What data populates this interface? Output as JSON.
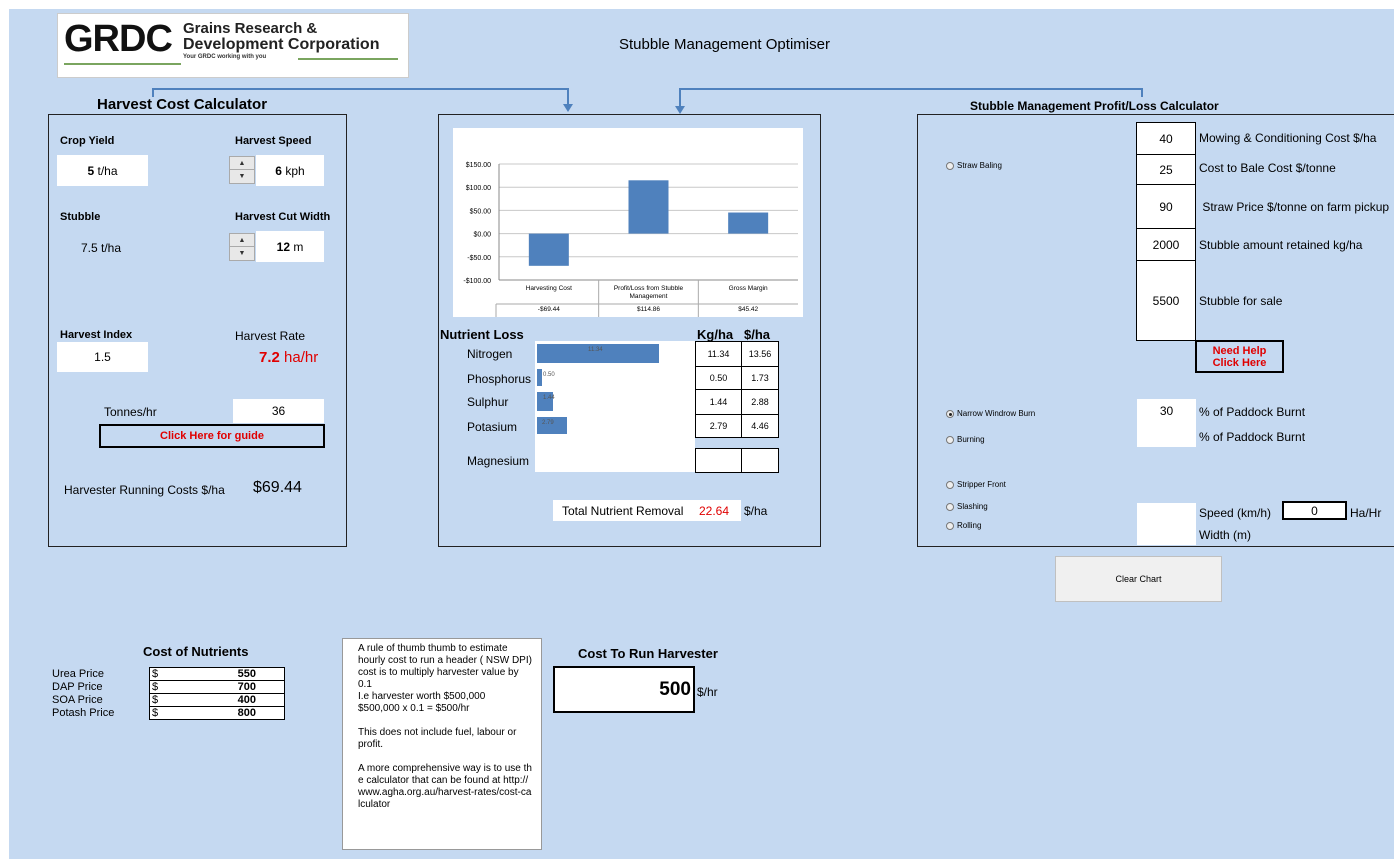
{
  "header": {
    "logo_main": "GRDC",
    "logo_line1": "Grains Research &",
    "logo_line2": "Development Corporation",
    "logo_tagline": "Your GRDC working with you",
    "title": "Stubble Management Optimiser"
  },
  "harvest_calc": {
    "title": "Harvest Cost Calculator",
    "crop_yield_label": "Crop Yield",
    "crop_yield_value": "5",
    "crop_yield_unit": "t/ha",
    "harvest_speed_label": "Harvest Speed",
    "harvest_speed_value": "6",
    "harvest_speed_unit": "kph",
    "stubble_label": "Stubble",
    "stubble_value": "7.5 t/ha",
    "cut_width_label": "Harvest Cut Width",
    "cut_width_value": "12",
    "cut_width_unit": "m",
    "harvest_index_label": "Harvest Index",
    "harvest_index_value": "1.5",
    "harvest_rate_label": "Harvest Rate",
    "harvest_rate_value": "7.2",
    "harvest_rate_unit": "ha/hr",
    "tonnes_hr_label": "Tonnes/hr",
    "tonnes_hr_value": "36",
    "guide_button": "Click Here for guide",
    "running_cost_label": "Harvester Running Costs $/ha",
    "running_cost_value": "$69.44"
  },
  "chart_data": {
    "type": "bar",
    "categories": [
      "Harvesting Cost",
      "Profit/Loss from Stubble Management",
      "Gross Margin"
    ],
    "values": [
      -69.44,
      114.86,
      45.42
    ],
    "value_labels": [
      "-$69.44",
      "$114.86",
      "$45.42"
    ],
    "ylim": [
      -100,
      150
    ],
    "yticks": [
      "$150.00",
      "$100.00",
      "$50.00",
      "$0.00",
      "-$50.00",
      "-$100.00"
    ],
    "ytick_values": [
      150,
      100,
      50,
      0,
      -50,
      -100
    ],
    "bar_color": "#4f81bd",
    "grid": true
  },
  "nutrients": {
    "title": "Nutrient Loss",
    "col_kg": "Kg/ha",
    "col_dollar": "$/ha",
    "rows": [
      {
        "name": "Nitrogen",
        "kg": "11.34",
        "dollar": "13.56",
        "bar": 11.34,
        "bar_label": "11.34"
      },
      {
        "name": "Phosphorus",
        "kg": "0.50",
        "dollar": "1.73",
        "bar": 0.5,
        "bar_label": "0.50"
      },
      {
        "name": "Sulphur",
        "kg": "1.44",
        "dollar": "2.88",
        "bar": 1.44,
        "bar_label": "1.44"
      },
      {
        "name": "Potasium",
        "kg": "2.79",
        "dollar": "4.46",
        "bar": 2.79,
        "bar_label": "2.79"
      },
      {
        "name": "Magnesium",
        "kg": "",
        "dollar": "",
        "bar": 0,
        "bar_label": ""
      }
    ],
    "bar_max": 13,
    "total_label": "Total Nutrient Removal",
    "total_value": "22.64",
    "total_unit": "$/ha"
  },
  "profit_loss": {
    "title": "Stubble Management Profit/Loss Calculator",
    "straw_baling": "Straw Baling",
    "rows": [
      {
        "value": "40",
        "label": "Mowing & Conditioning Cost $/ha"
      },
      {
        "value": "25",
        "label": "Cost to Bale Cost $/tonne"
      },
      {
        "value": "90",
        "label": " Straw Price $/tonne on farm pickup"
      },
      {
        "value": "2000",
        "label": "Stubble amount retained kg/ha"
      },
      {
        "value": "5500",
        "label": "Stubble for sale"
      }
    ],
    "need_help_line1": "Need Help",
    "need_help_line2": "Click Here",
    "narrow_windrow": "Narrow Windrow Burn",
    "narrow_windrow_value": "30",
    "narrow_windrow_unit": "% of Paddock Burnt",
    "burning": "Burning",
    "burning_unit": "% of Paddock Burnt",
    "stripper_front": "Stripper Front",
    "slashing": "Slashing",
    "rolling": "Rolling",
    "speed_label": "Speed (km/h)",
    "speed_result": "0",
    "speed_result_unit": "Ha/Hr",
    "width_label": "Width (m)",
    "clear_chart": "Clear Chart"
  },
  "cost_nutrients": {
    "title": "Cost of Nutrients",
    "items": [
      {
        "label": "Urea Price",
        "currency": "$",
        "value": "550"
      },
      {
        "label": "DAP Price",
        "currency": "$",
        "value": "700"
      },
      {
        "label": "SOA Price",
        "currency": "$",
        "value": "400"
      },
      {
        "label": "Potash Price",
        "currency": "$",
        "value": "800"
      }
    ]
  },
  "note": {
    "p1": "A rule of thumb  thumb to estimate hourly cost to run a header ( NSW DPI) cost is to multiply harvester value by 0.1",
    "p1b": "I.e harvester worth $500,000",
    "p1c": "$500,000 x 0.1 = $500/hr",
    "p2": "This does not include fuel, labour or profit.",
    "p3": "A more comprehensive way is to use the calculator  that can be found at http://www.agha.org.au/harvest-rates/cost-calculator"
  },
  "run_cost": {
    "title": "Cost To Run Harvester",
    "value": "500",
    "unit": "$/hr"
  }
}
